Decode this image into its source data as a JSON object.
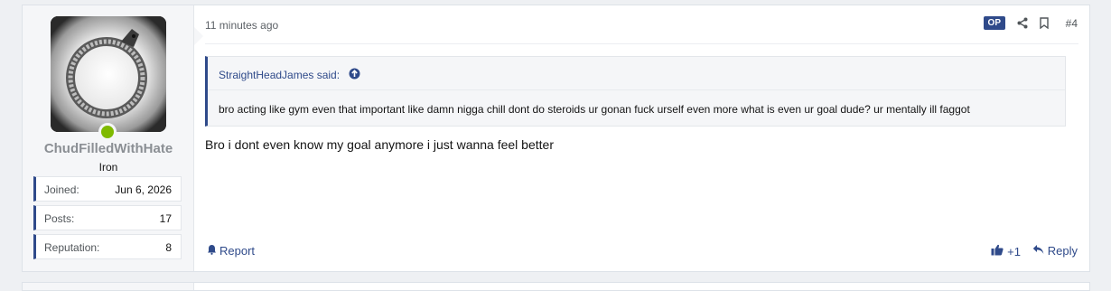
{
  "post": {
    "user": {
      "name": "ChudFilledWithHate",
      "title": "Iron",
      "online": true,
      "stats": [
        {
          "label": "Joined:",
          "value": "Jun 6, 2026"
        },
        {
          "label": "Posts:",
          "value": "17"
        },
        {
          "label": "Reputation:",
          "value": "8"
        }
      ]
    },
    "header": {
      "time": "11 minutes ago",
      "op_badge": "OP",
      "post_number": "#4"
    },
    "quote": {
      "author": "StraightHeadJames said:",
      "text": "bro acting like gym even that important like damn nigga chill dont do steroids ur gonan fuck urself even more what is even ur goal dude? ur mentally ill faggot"
    },
    "message": "Bro i dont even know my goal anymore i just wanna feel better",
    "footer": {
      "report": "Report",
      "like": "+1",
      "reply": "Reply"
    }
  },
  "colors": {
    "accent": "#2f4a8a",
    "online": "#7fba00",
    "username": "#8b8f94"
  },
  "icons": [
    "share-icon",
    "bookmark-icon",
    "arrow-up-circle-icon",
    "bell-icon",
    "thumbs-up-icon",
    "reply-icon"
  ]
}
